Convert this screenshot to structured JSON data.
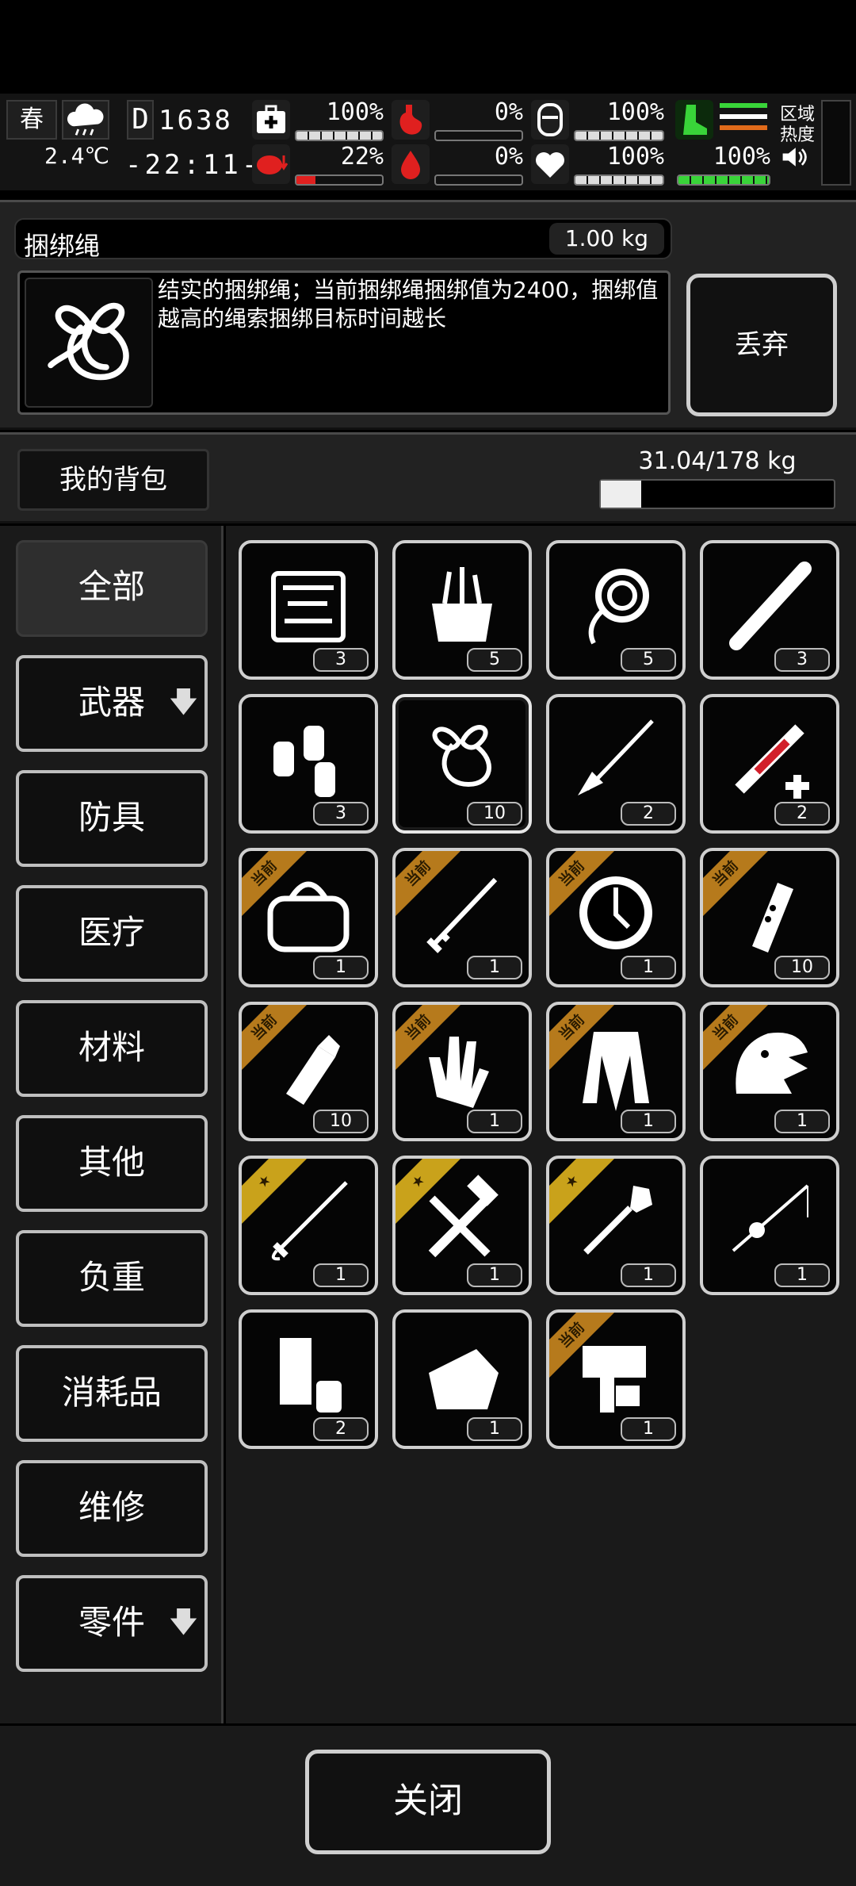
{
  "status": {
    "season": "春",
    "temperature": "2.4℃",
    "day": "1638",
    "clock": "-22:11-",
    "stats": [
      {
        "key": "health",
        "value": "100%",
        "level": 1.0,
        "icon": "medkit-icon"
      },
      {
        "key": "hunger",
        "value": "0%",
        "level": 0.0,
        "icon": "stomach-icon"
      },
      {
        "key": "armor",
        "value": "100%",
        "level": 1.0,
        "icon": "helmet-icon"
      },
      {
        "key": "stamina",
        "value": "100%",
        "level": 1.0,
        "icon": "boot-icon"
      },
      {
        "key": "brain",
        "value": "22%",
        "level": 0.22,
        "icon": "brain-icon",
        "color": "#e0201f"
      },
      {
        "key": "blood",
        "value": "0%",
        "level": 0.0,
        "icon": "blood-drop-icon",
        "color": "#e0201f"
      },
      {
        "key": "heart",
        "value": "100%",
        "level": 1.0,
        "icon": "heart-icon"
      },
      {
        "key": "stamina2",
        "value": "100%",
        "level": 1.0,
        "icon": "",
        "color": "#2fbf2f"
      }
    ],
    "zone_heat_label": "区域热度"
  },
  "detail": {
    "name": "捆绑绳",
    "weight": "1.00 kg",
    "description": "结实的捆绑绳；当前捆绑绳捆绑值为2400，捆绑值越高的绳索捆绑目标时间越长",
    "discard_label": "丢弃"
  },
  "bag": {
    "label": "我的背包",
    "capacity": "31.04/178 kg",
    "fill": 0.174
  },
  "categories": [
    {
      "label": "全部",
      "active": true
    },
    {
      "label": "武器",
      "arrow": "🡇"
    },
    {
      "label": "防具"
    },
    {
      "label": "医疗"
    },
    {
      "label": "材料"
    },
    {
      "label": "其他"
    },
    {
      "label": "负重"
    },
    {
      "label": "消耗品"
    },
    {
      "label": "维修"
    },
    {
      "label": "零件",
      "arrow": "🡇"
    }
  ],
  "ribbon_current": "当前",
  "ribbon_star": "★",
  "items": [
    {
      "name": "toolkit",
      "count": "3"
    },
    {
      "name": "tool-bag",
      "count": "5"
    },
    {
      "name": "rope-coil",
      "count": "5"
    },
    {
      "name": "pipe",
      "count": "3"
    },
    {
      "name": "spray-cans",
      "count": "3"
    },
    {
      "name": "binding-rope",
      "count": "10",
      "selected": true
    },
    {
      "name": "spear-brush",
      "count": "2"
    },
    {
      "name": "medical-syringe",
      "count": "2"
    },
    {
      "name": "duffel-bag",
      "count": "1",
      "ribbon": "cur"
    },
    {
      "name": "sword",
      "count": "1",
      "ribbon": "cur"
    },
    {
      "name": "shield",
      "count": "1",
      "ribbon": "cur"
    },
    {
      "name": "flashlight",
      "count": "10",
      "ribbon": "cur"
    },
    {
      "name": "grenade",
      "count": "10",
      "ribbon": "cur"
    },
    {
      "name": "gloves",
      "count": "1",
      "ribbon": "cur"
    },
    {
      "name": "coat",
      "count": "1",
      "ribbon": "cur"
    },
    {
      "name": "dino-mask",
      "count": "1",
      "ribbon": "cur"
    },
    {
      "name": "katana",
      "count": "1",
      "ribbon": "star"
    },
    {
      "name": "hammer-wrench",
      "count": "1",
      "ribbon": "star"
    },
    {
      "name": "shovel",
      "count": "1",
      "ribbon": "star"
    },
    {
      "name": "fishing-rod",
      "count": "1"
    },
    {
      "name": "can-bundle",
      "count": "2"
    },
    {
      "name": "cloth",
      "count": "1"
    },
    {
      "name": "nail-gun",
      "count": "1",
      "ribbon": "cur"
    }
  ],
  "close_label": "关闭"
}
